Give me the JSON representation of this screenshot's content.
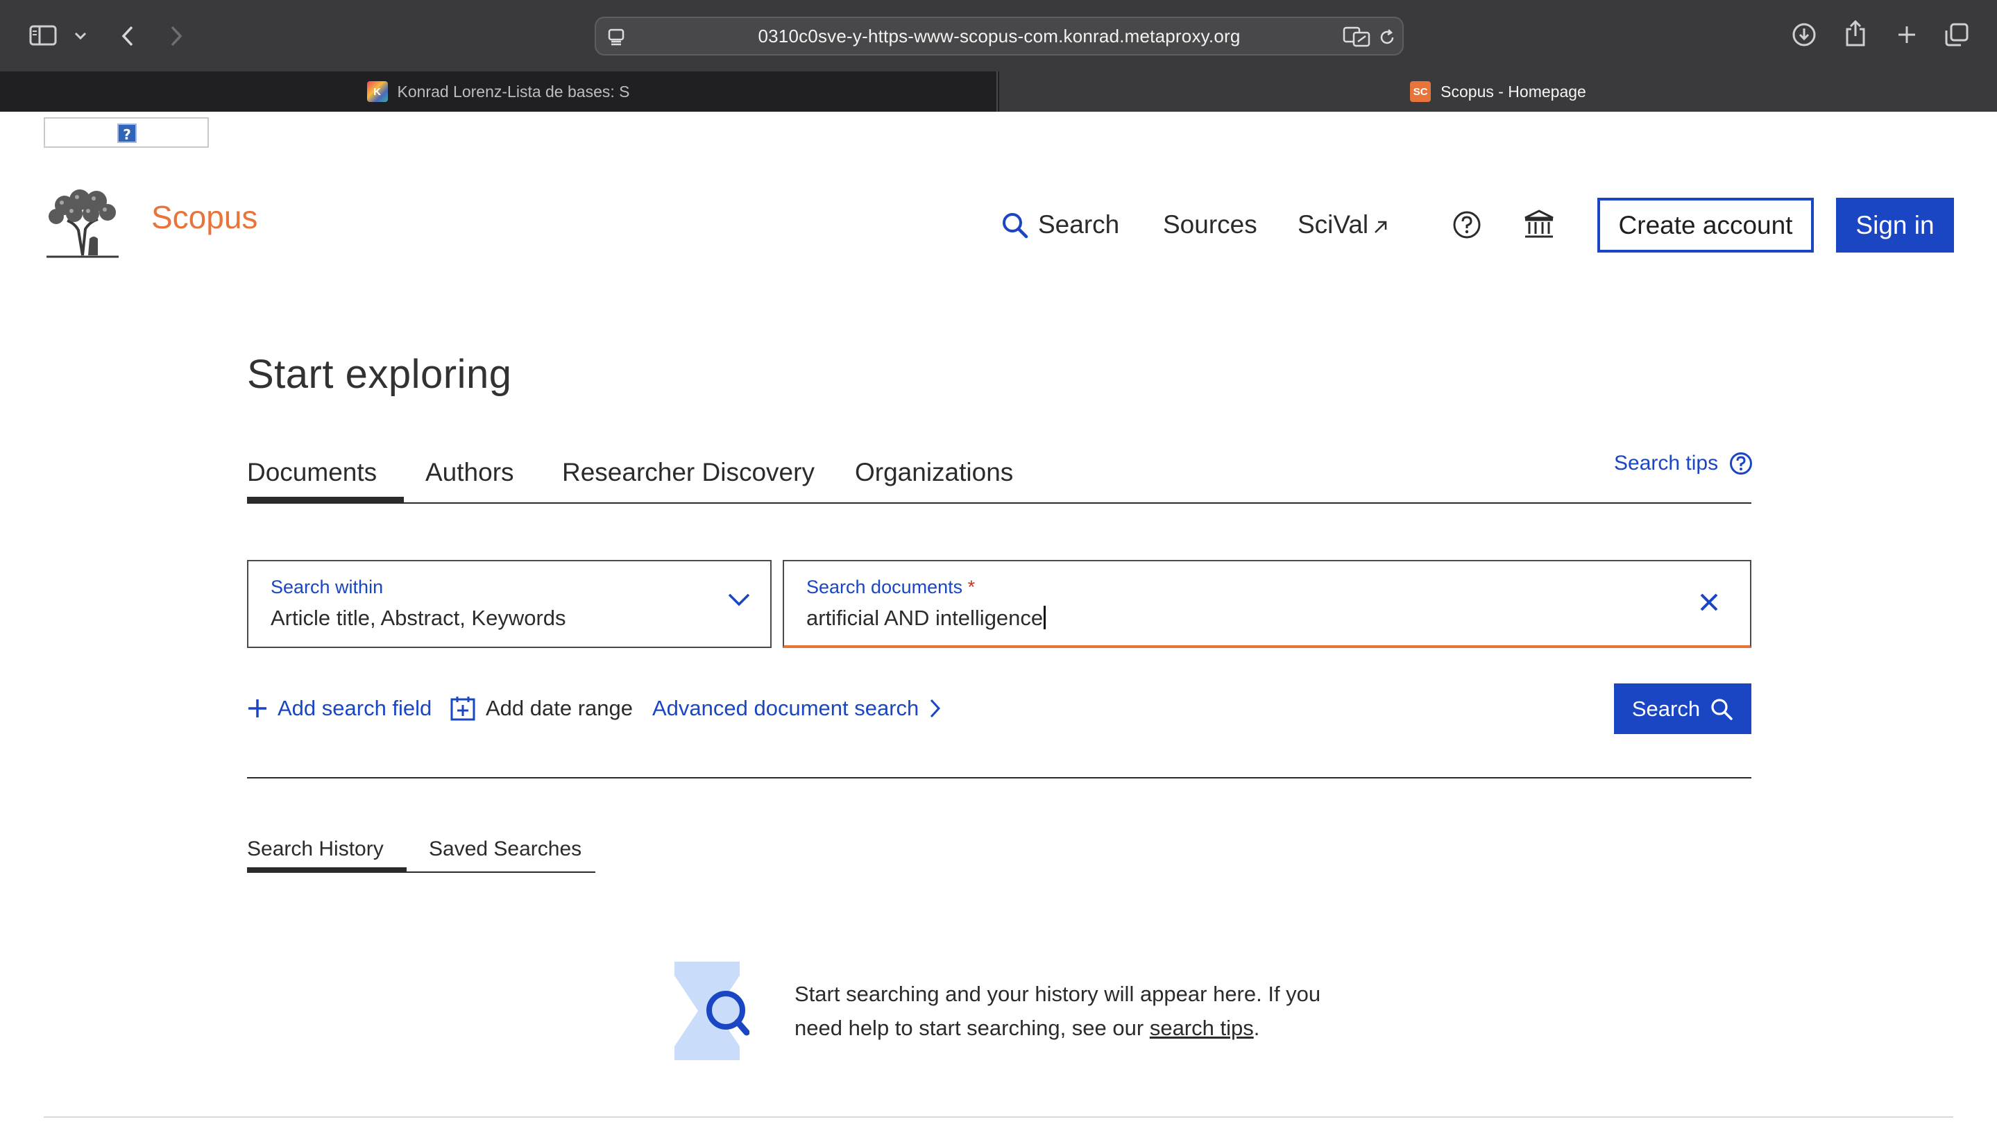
{
  "browser": {
    "url": "0310c0sve-y-https-www-scopus-com.konrad.metaproxy.org",
    "tabs": [
      {
        "label": "Konrad Lorenz-Lista de bases: S",
        "favicon": "K",
        "active": false
      },
      {
        "label": "Scopus - Homepage",
        "favicon": "SC",
        "active": true
      }
    ],
    "icons": [
      "sidebar-icon",
      "chevron-down-icon",
      "back-icon",
      "forward-icon",
      "page-menu-icon",
      "translate-icon",
      "reload-icon",
      "download-icon",
      "share-icon",
      "new-tab-icon",
      "tab-overview-icon"
    ]
  },
  "page": {
    "broken_image_glyph": "?",
    "brand": "Scopus",
    "nav": {
      "search": "Search",
      "sources": "Sources",
      "scival": "SciVal"
    },
    "create_account": "Create account",
    "sign_in": "Sign in",
    "title": "Start exploring",
    "tabs": [
      "Documents",
      "Authors",
      "Researcher Discovery",
      "Organizations"
    ],
    "active_tab": "Documents",
    "search_tips": "Search tips",
    "search_within": {
      "label": "Search within",
      "value": "Article title, Abstract, Keywords"
    },
    "search_documents": {
      "label": "Search documents",
      "required_mark": "*",
      "value": "artificial AND intelligence"
    },
    "add_search_field": "Add search field",
    "add_date_range": "Add date range",
    "advanced_search": "Advanced document search",
    "search_button": "Search",
    "history_tabs": [
      "Search History",
      "Saved Searches"
    ],
    "empty_state": {
      "text_before": "Start searching and your history will appear here. If you need help to start searching, see our ",
      "link": "search tips",
      "text_after": "."
    }
  },
  "colors": {
    "brand_orange": "#e8743b",
    "primary_blue": "#1a46c3",
    "chrome_dark": "#3a3a3c",
    "tabbar_dark": "#1f1f21",
    "illustration_light_blue": "#c9dcfa"
  }
}
